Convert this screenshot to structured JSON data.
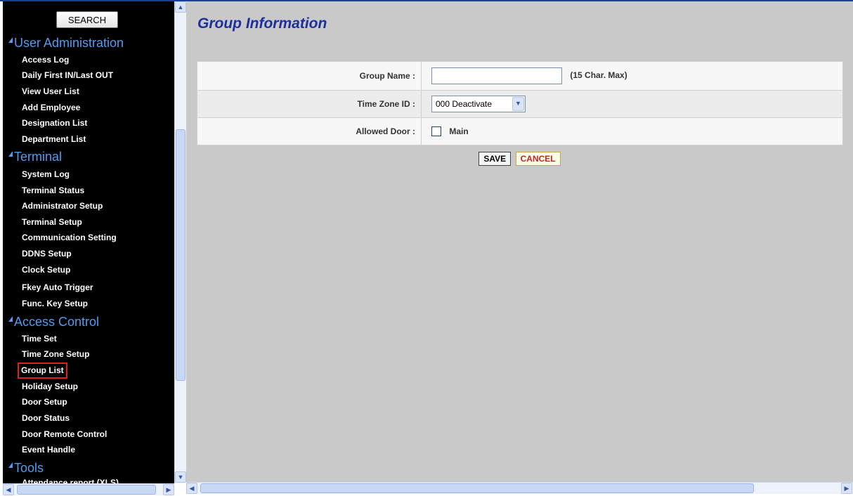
{
  "sidebar": {
    "search_label": "SEARCH",
    "sections": [
      {
        "title": "User Administration",
        "items": [
          "Access Log",
          "Daily First IN/Last OUT",
          "View User List",
          "Add Employee",
          "Designation List",
          "Department List"
        ]
      },
      {
        "title": "Terminal",
        "items": [
          "System Log",
          "Terminal Status",
          "Administrator Setup",
          "Terminal Setup",
          "Communication Setting",
          "DDNS Setup",
          "Clock Setup",
          "Fkey Auto Trigger",
          "Func. Key Setup"
        ]
      },
      {
        "title": "Access Control",
        "items": [
          "Time Set",
          "Time Zone Setup",
          "Group List",
          "Holiday Setup",
          "Door Setup",
          "Door Status",
          "Door Remote Control",
          "Event Handle"
        ]
      },
      {
        "title": "Tools",
        "items": [
          "Attendance report (XLS)"
        ]
      }
    ],
    "selected_item": "Group List"
  },
  "main": {
    "title": "Group Information",
    "form": {
      "group_name_label": "Group Name :",
      "group_name_value": "",
      "group_name_hint": "(15 Char. Max)",
      "time_zone_label": "Time Zone ID :",
      "time_zone_value": "000 Deactivate",
      "allowed_door_label": "Allowed Door :",
      "door_option": "Main",
      "door_checked": false
    },
    "buttons": {
      "save": "SAVE",
      "cancel": "CANCEL"
    }
  },
  "colors": {
    "sidebar_bg": "#000000",
    "section_heading": "#4f9cf2",
    "title": "#1d2f9c",
    "content_bg": "#c9c9c9",
    "cancel_text": "#c0262a",
    "selected_outline": "#e01f1f"
  },
  "icons": {
    "scroll_up": "scroll-up-arrow-icon",
    "scroll_down": "scroll-down-arrow-icon",
    "scroll_left": "scroll-left-arrow-icon",
    "scroll_right": "scroll-right-arrow-icon",
    "section_marker": "triangle-icon",
    "dropdown": "chevron-down-icon"
  }
}
